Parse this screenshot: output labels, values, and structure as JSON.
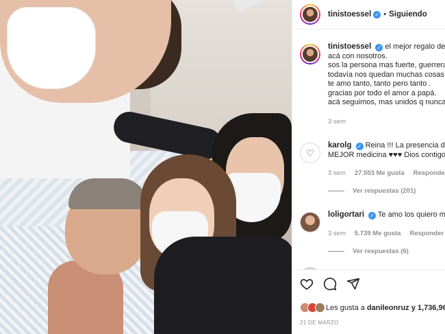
{
  "post": {
    "username": "tinistoessel",
    "follow_label": "Siguiendo",
    "separator": "•",
    "caption_lines": [
      "el mejor regalo de cu",
      "acá con nosotros.",
      "sos la persona mas fuerte, guerrera",
      "todavía nos quedan muchas cosas p",
      "te amo tanto, tanto pero tanto .",
      "gracias por todo el amor a papá.",
      "acá seguimos, mas unidos q nunca"
    ],
    "caption_time": "3 sem"
  },
  "comments": [
    {
      "username": "karolg",
      "lines": [
        "Reina !!! La presencia de la",
        "MEJOR medicina ♥♥♥ Dios contigo"
      ],
      "time": "3 sem",
      "likes": "27.553 Me gusta",
      "reply_label": "Responder",
      "view_replies": "Ver respuestas (201)"
    },
    {
      "username": "loligortari",
      "lines": [
        "Te amo los quiero mu"
      ],
      "time": "3 sem",
      "likes": "5.739 Me gusta",
      "reply_label": "Responder",
      "view_replies": "Ver respuestas (6)"
    }
  ],
  "footer": {
    "likes_prefix": "Les gusta a ",
    "liked_by": "danileonruz",
    "likes_suffix": " y 1,736,96",
    "date": "21 DE MARZO"
  },
  "icons": [
    "like-icon",
    "comment-icon",
    "share-icon",
    "verified-icon"
  ],
  "colors": {
    "verified": "#3897f0",
    "muted": "#8e8e8e",
    "text": "#262626"
  }
}
